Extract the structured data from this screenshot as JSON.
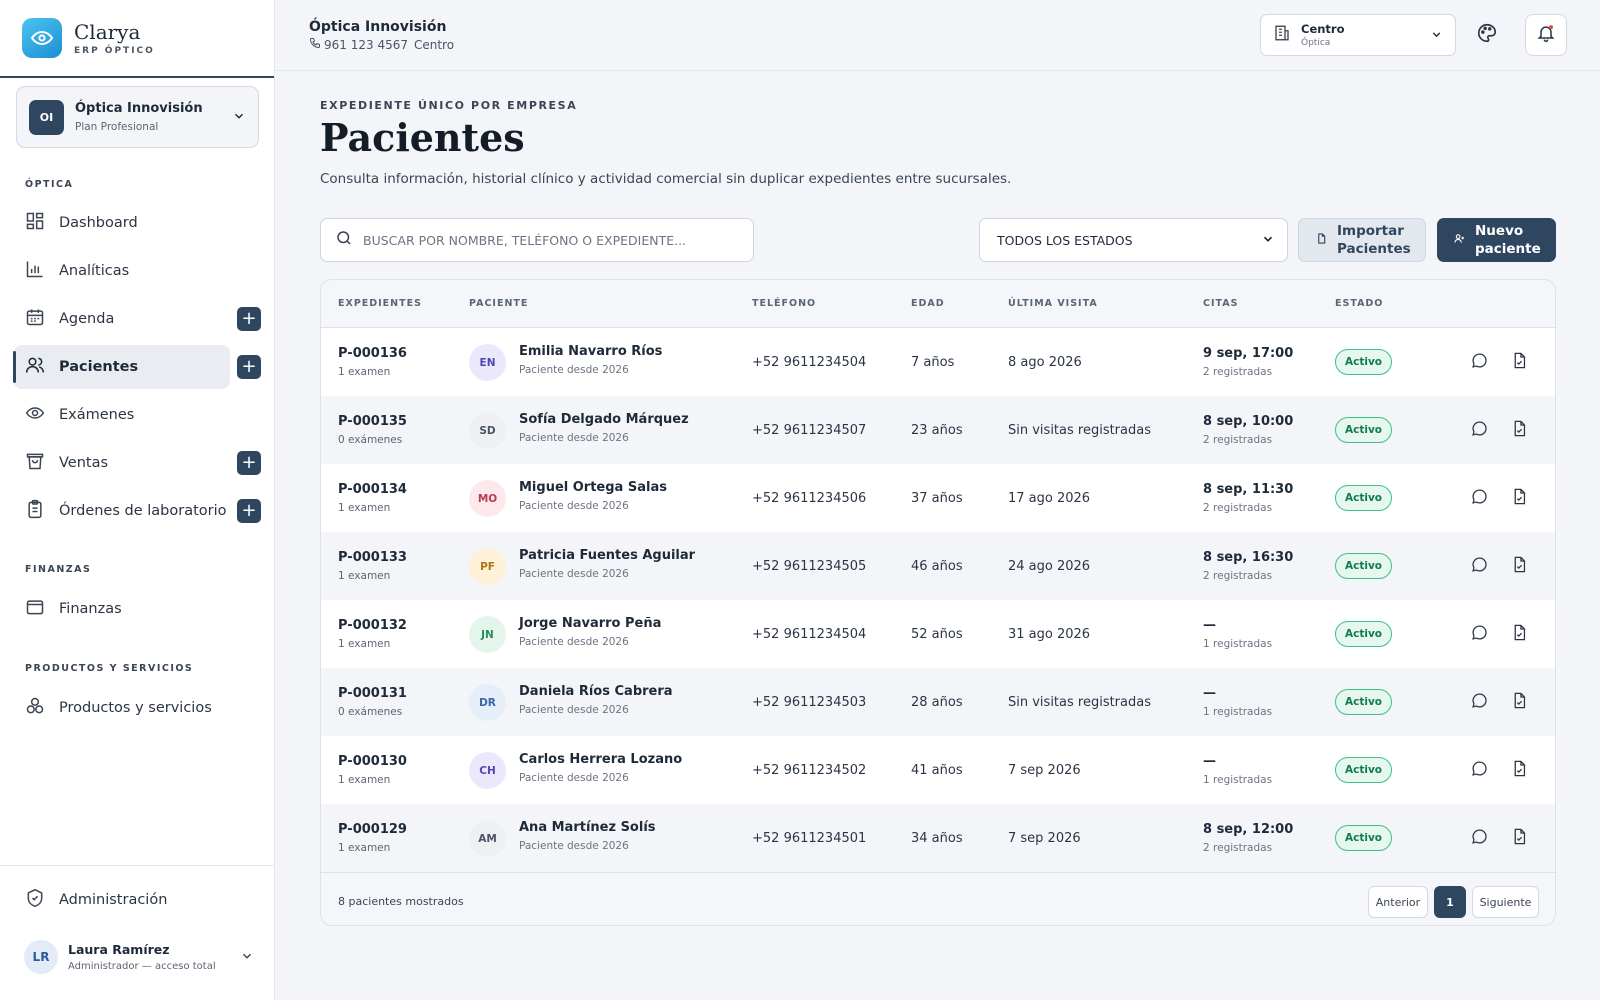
{
  "brand": {
    "name": "Clarya",
    "subtitle": "ERP ÓPTICO"
  },
  "company": {
    "initials": "OI",
    "name": "Óptica Innovisión",
    "plan": "Plan Profesional"
  },
  "sidebar": {
    "section_optica": "ÓPTICA",
    "items": [
      {
        "label": "Dashboard",
        "icon": "dashboard-icon"
      },
      {
        "label": "Analíticas",
        "icon": "bar-chart-icon"
      },
      {
        "label": "Agenda",
        "icon": "calendar-icon"
      },
      {
        "label": "Pacientes",
        "icon": "users-icon"
      },
      {
        "label": "Exámenes",
        "icon": "eye-icon"
      },
      {
        "label": "Ventas",
        "icon": "shopping-bag-icon"
      },
      {
        "label": "Órdenes de laboratorio",
        "icon": "clipboard-icon"
      }
    ],
    "section_finanzas": "FINANZAS",
    "finanzas_label": "Finanzas",
    "section_productos": "PRODUCTOS Y SERVICIOS",
    "productos_label": "Productos y servicios",
    "admin_label": "Administración",
    "active_item": "Pacientes"
  },
  "user": {
    "initials": "LR",
    "name": "Laura Ramírez",
    "role": "Administrador — acceso total"
  },
  "topbar": {
    "title": "Óptica Innovisión",
    "phone": "961 123 4567",
    "location": "Centro",
    "branch_name": "Centro",
    "branch_type": "Óptica"
  },
  "page": {
    "eyebrow": "EXPEDIENTE ÚNICO POR EMPRESA",
    "title": "Pacientes",
    "description": "Consulta información, historial clínico y actividad comercial sin duplicar expedientes entre sucursales."
  },
  "toolbar": {
    "search_placeholder": "BUSCAR POR NOMBRE, TELÉFONO O EXPEDIENTE...",
    "status_value": "TODOS LOS ESTADOS",
    "import_label_1": "Importar",
    "import_label_2": "Pacientes",
    "new_label_1": "Nuevo",
    "new_label_2": "paciente"
  },
  "table": {
    "headers": [
      "EXPEDIENTES",
      "PACIENTE",
      "TELÉFONO",
      "EDAD",
      "ÚLTIMA VISITA",
      "CITAS",
      "ESTADO"
    ],
    "rows": [
      {
        "id": "P-000136",
        "exams": "1 examen",
        "initials": "EN",
        "avatar_bg": "#ece8fb",
        "avatar_fg": "#4f46b5",
        "name": "Emilia Navarro Ríos",
        "since": "Paciente desde 2026",
        "phone": "+52 9611234504",
        "age": "7 años",
        "last_visit": "8 ago 2026",
        "cita": "9 sep, 17:00",
        "cita_count": "2 registradas",
        "status": "Activo"
      },
      {
        "id": "P-000135",
        "exams": "0 exámenes",
        "initials": "SD",
        "avatar_bg": "#eef0f3",
        "avatar_fg": "#4a5565",
        "name": "Sofía Delgado Márquez",
        "since": "Paciente desde 2026",
        "phone": "+52 9611234507",
        "age": "23 años",
        "last_visit": "Sin visitas registradas",
        "cita": "8 sep, 10:00",
        "cita_count": "2 registradas",
        "status": "Activo"
      },
      {
        "id": "P-000134",
        "exams": "1 examen",
        "initials": "MO",
        "avatar_bg": "#fde8ec",
        "avatar_fg": "#b43a56",
        "name": "Miguel Ortega Salas",
        "since": "Paciente desde 2026",
        "phone": "+52 9611234506",
        "age": "37 años",
        "last_visit": "17 ago 2026",
        "cita": "8 sep, 11:30",
        "cita_count": "2 registradas",
        "status": "Activo"
      },
      {
        "id": "P-000133",
        "exams": "1 examen",
        "initials": "PF",
        "avatar_bg": "#fdf1d8",
        "avatar_fg": "#b0711c",
        "name": "Patricia Fuentes Aguilar",
        "since": "Paciente desde 2026",
        "phone": "+52 9611234505",
        "age": "46 años",
        "last_visit": "24 ago 2026",
        "cita": "8 sep, 16:30",
        "cita_count": "2 registradas",
        "status": "Activo"
      },
      {
        "id": "P-000132",
        "exams": "1 examen",
        "initials": "JN",
        "avatar_bg": "#e4f5ec",
        "avatar_fg": "#2e8a5d",
        "name": "Jorge Navarro Peña",
        "since": "Paciente desde 2026",
        "phone": "+52 9611234504",
        "age": "52 años",
        "last_visit": "31 ago 2026",
        "cita": "—",
        "cita_count": "1 registradas",
        "status": "Activo"
      },
      {
        "id": "P-000131",
        "exams": "0 exámenes",
        "initials": "DR",
        "avatar_bg": "#e6eefa",
        "avatar_fg": "#3764a8",
        "name": "Daniela Ríos Cabrera",
        "since": "Paciente desde 2026",
        "phone": "+52 9611234503",
        "age": "28 años",
        "last_visit": "Sin visitas registradas",
        "cita": "—",
        "cita_count": "1 registradas",
        "status": "Activo"
      },
      {
        "id": "P-000130",
        "exams": "1 examen",
        "initials": "CH",
        "avatar_bg": "#ece8fb",
        "avatar_fg": "#4f46b5",
        "name": "Carlos Herrera Lozano",
        "since": "Paciente desde 2026",
        "phone": "+52 9611234502",
        "age": "41 años",
        "last_visit": "7 sep 2026",
        "cita": "—",
        "cita_count": "1 registradas",
        "status": "Activo"
      },
      {
        "id": "P-000129",
        "exams": "1 examen",
        "initials": "AM",
        "avatar_bg": "#eef0f3",
        "avatar_fg": "#4a5565",
        "name": "Ana Martínez Solís",
        "since": "Paciente desde 2026",
        "phone": "+52 9611234501",
        "age": "34 años",
        "last_visit": "7 sep 2026",
        "cita": "8 sep, 12:00",
        "cita_count": "2 registradas",
        "status": "Activo"
      }
    ],
    "shown_text": "8 pacientes mostrados",
    "prev_label": "Anterior",
    "current_page": "1",
    "next_label": "Siguiente"
  },
  "colors": {
    "primary": "#2f4660",
    "accent": "#1b8fd1",
    "success": "#3fbf8a"
  }
}
